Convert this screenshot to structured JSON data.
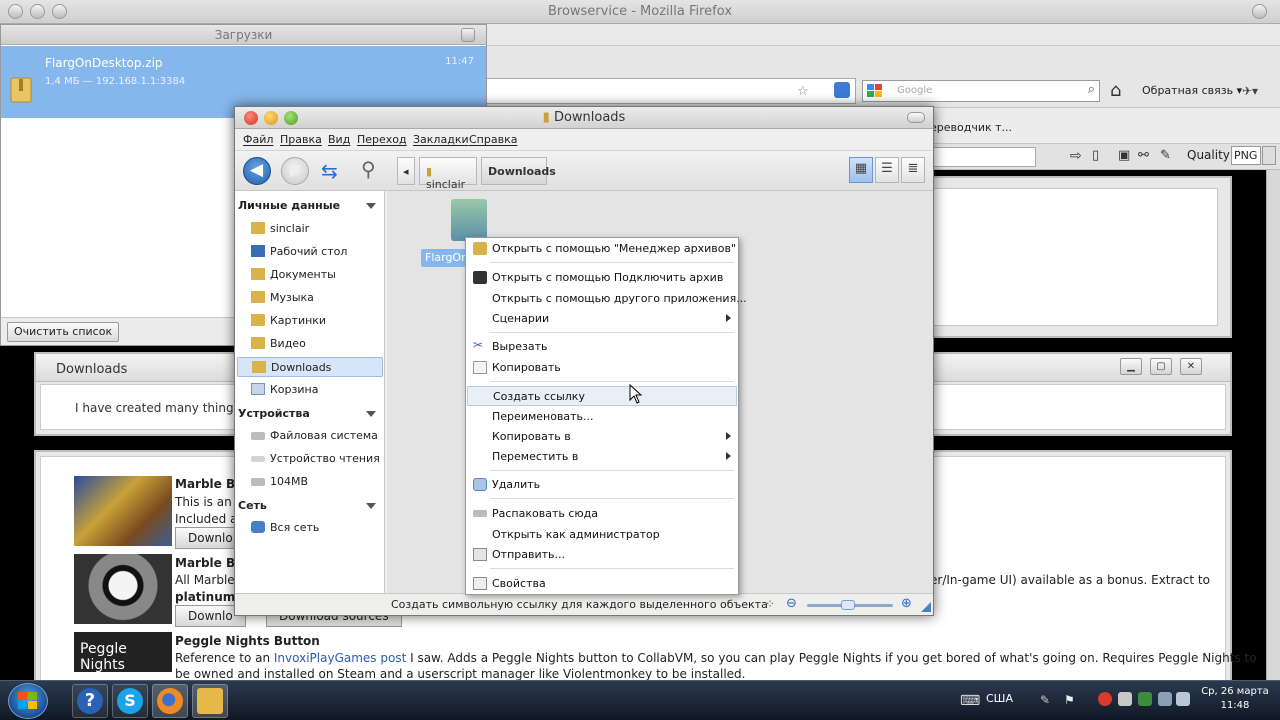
{
  "firefox": {
    "title": "Browservice - Mozilla Firefox",
    "search_placeholder": "Google",
    "feedback": "Обратная связь",
    "bookmark_partial": "ереводчик т...",
    "quality_label": "Quality",
    "quality_value": "PNG"
  },
  "page": {
    "downloads_header": "Downloads",
    "downloads_text": "I have created many things o",
    "items": [
      {
        "title": "Marble Bla",
        "line1": "This is an i",
        "line2": "Included a",
        "button": "Downlo"
      },
      {
        "title": "Marble Bla",
        "line1": "All Marble",
        "line1_tail": "er/In-game UI) available as a bonus. Extract to",
        "line2": "platinum/c",
        "button": "Downlo",
        "button2": "Download sources"
      },
      {
        "title": "Peggle Nights Button",
        "thumb_text": "Peggle Nights",
        "line1_pre": "Reference to an ",
        "line1_link": "InvoxiPlayGames post",
        "line1_post": " I saw. Adds a Peggle Nights button to CollabVM, so you can play Peggle Nights if you get bored of what's going on. Requires Peggle Nights to",
        "line2": "be owned and installed on Steam and a userscript manager like Violentmonkey to be installed."
      }
    ]
  },
  "downloads_window": {
    "title": "Загрузки",
    "file_name": "FlargOnDesktop.zip",
    "file_meta": "1,4 МБ — 192.168.1.1:3384",
    "file_time": "11:47",
    "clear_button": "Очистить список"
  },
  "nautilus": {
    "title": "Downloads",
    "menu": [
      "Файл",
      "Правка",
      "Вид",
      "Переход",
      "Закладки",
      "Справка"
    ],
    "path": [
      "sinclair",
      "Downloads"
    ],
    "sidebar": {
      "personal_header": "Личные данные",
      "personal": [
        "sinclair",
        "Рабочий стол",
        "Документы",
        "Музыка",
        "Картинки",
        "Видео",
        "Downloads",
        "Корзина"
      ],
      "devices_header": "Устройства",
      "devices": [
        "Файловая система",
        "Устройство чтения д...",
        "104MB"
      ],
      "network_header": "Сеть",
      "network": [
        "Вся сеть"
      ]
    },
    "file_label": "FlargOn",
    "status": "Создать символьную ссылку для каждого выделенного объекта"
  },
  "context_menu": {
    "items": [
      {
        "label": "Открыть с помощью \"Менеджер архивов\"",
        "icon": "archive-manager-icon"
      },
      {
        "label": "Открыть с помощью Подключить архив",
        "icon": "mount-archive-icon"
      },
      {
        "label": "Открыть с помощью другого приложения...",
        "icon": ""
      },
      {
        "label": "Сценарии",
        "icon": ""
      },
      {
        "label": "Вырезать",
        "icon": "scissors-icon"
      },
      {
        "label": "Копировать",
        "icon": "copy-icon"
      },
      {
        "label": "Создать ссылку",
        "icon": ""
      },
      {
        "label": "Переименовать...",
        "icon": ""
      },
      {
        "label": "Копировать в",
        "icon": ""
      },
      {
        "label": "Переместить в",
        "icon": ""
      },
      {
        "label": "Удалить",
        "icon": "trash-icon"
      },
      {
        "label": "Распаковать сюда",
        "icon": "extract-icon"
      },
      {
        "label": "Открыть как администратор",
        "icon": ""
      },
      {
        "label": "Отправить...",
        "icon": "send-icon"
      },
      {
        "label": "Свойства",
        "icon": "properties-icon"
      }
    ]
  },
  "taskbar": {
    "lang": "США",
    "date": "Ср, 26 марта",
    "time": "11:48"
  }
}
